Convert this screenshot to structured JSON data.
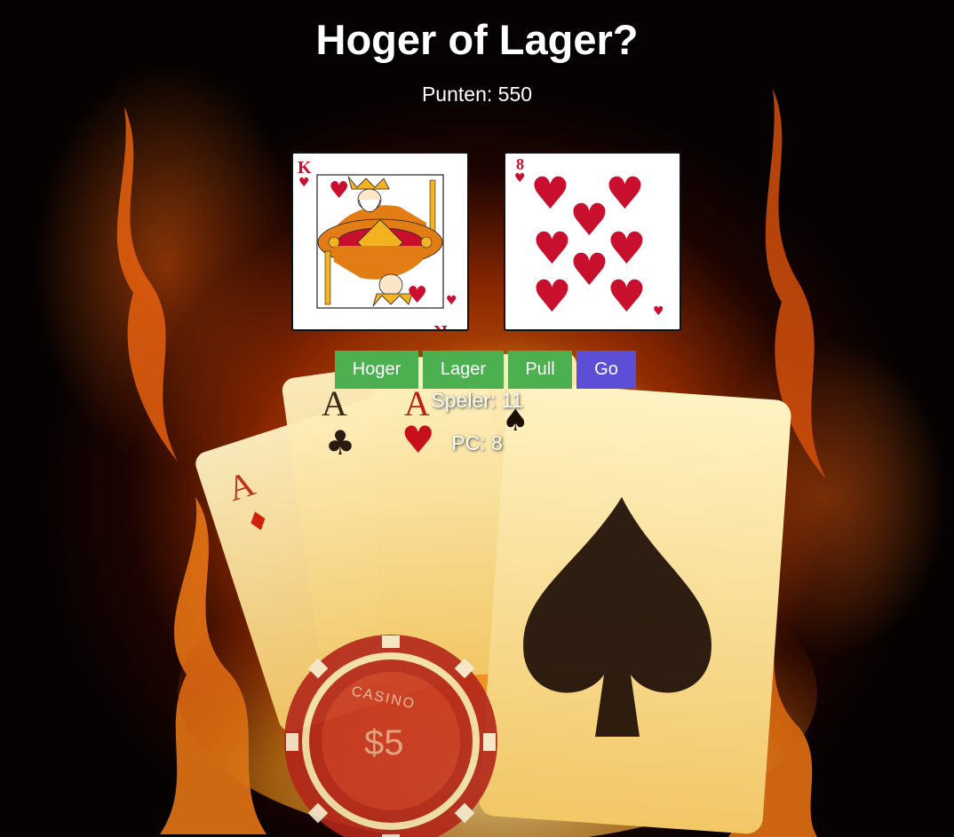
{
  "title": "Hoger of Lager?",
  "score": "Punten: 550",
  "cards": {
    "left": {
      "rank": "K",
      "suit": "hearts"
    },
    "right": {
      "rank": "8",
      "suit": "hearts"
    }
  },
  "buttons": {
    "hoger": "Hoger",
    "lager": "Lager",
    "pull": "Pull",
    "go": "Go"
  },
  "status": {
    "speler": "Speler: 11",
    "pc": "PC: 8"
  },
  "background": {
    "chip_text": "CASINO",
    "chip_value": "$5"
  },
  "colors": {
    "green_button": "#4caf50",
    "blue_button": "#5c4fd6",
    "heart_red": "#c8102e"
  }
}
